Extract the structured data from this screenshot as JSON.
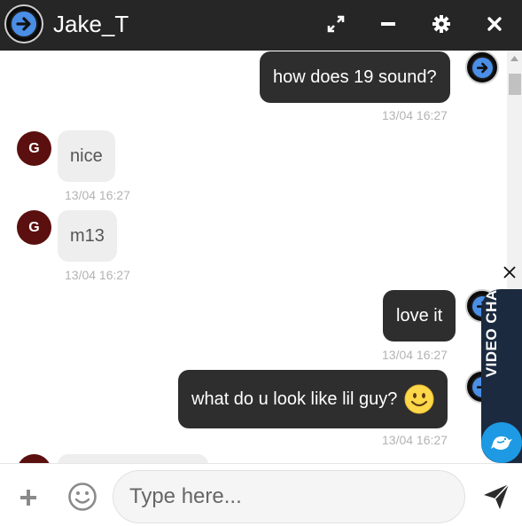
{
  "header": {
    "title": "Jake_T",
    "bg_color": "#262626",
    "buttons": [
      "expand-icon",
      "minimize-icon",
      "gear-icon",
      "close-icon"
    ]
  },
  "messages": [
    {
      "dir": "out",
      "text": "how does 19 sound?",
      "time": "13/04 16:27"
    },
    {
      "dir": "in",
      "avatar": "G",
      "text": "nice",
      "time": "13/04 16:27"
    },
    {
      "dir": "in",
      "avatar": "G",
      "text": "m13",
      "time": "13/04 16:27"
    },
    {
      "dir": "out",
      "text": "love it",
      "time": "13/04 16:27"
    },
    {
      "dir": "out",
      "text": "what do u look like lil guy?",
      "emoji": "slightly-smiling-face",
      "time": "13/04 16:27"
    }
  ],
  "video_chat": {
    "label": "VIDEO CHAT"
  },
  "composer": {
    "placeholder": "Type here..."
  },
  "colors": {
    "outgoing_bubble": "#2e2e2e",
    "incoming_bubble": "#eeeeee",
    "incoming_avatar": "#5b0f0f",
    "video_tab": "#1c2a3f",
    "bird_button": "#1d9ae3"
  }
}
